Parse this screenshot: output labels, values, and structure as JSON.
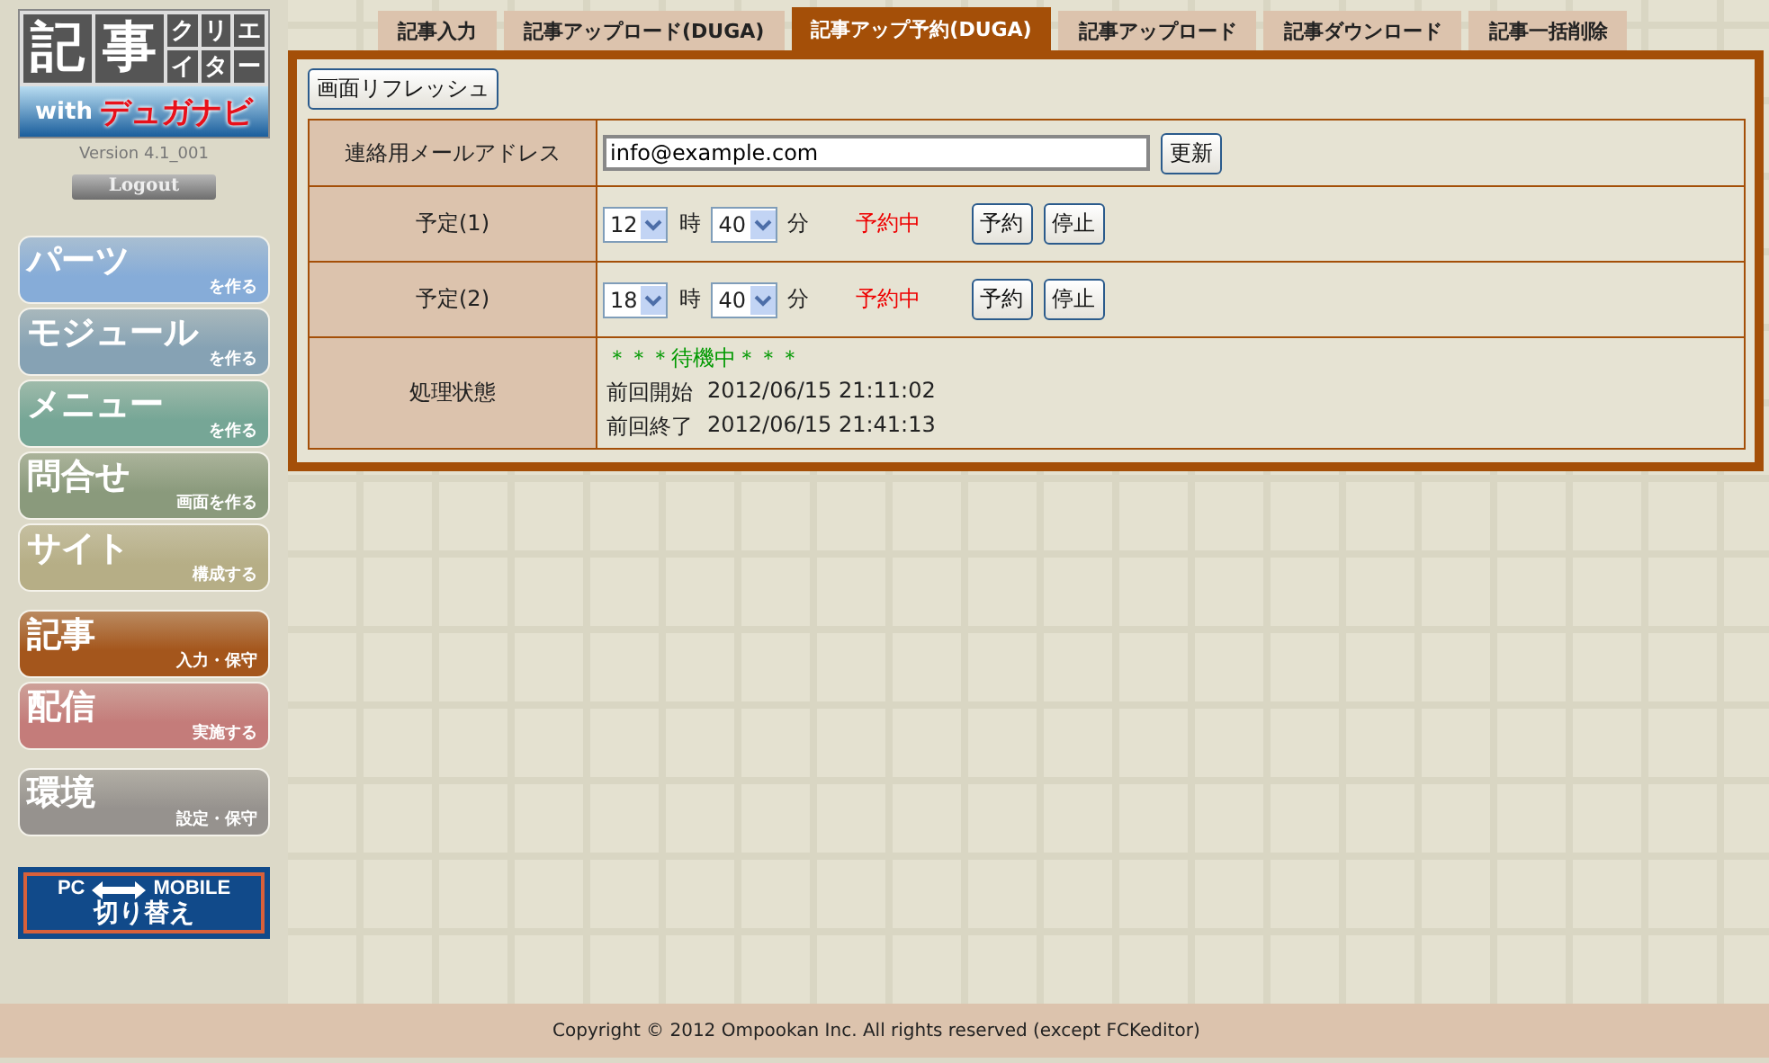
{
  "logo": {
    "main": [
      "記",
      "事"
    ],
    "cells": [
      "ク",
      "リ",
      "エ",
      "イ",
      "タ",
      "ー"
    ],
    "with": "with",
    "brand": "デュガナビ"
  },
  "version": "Version 4.1_001",
  "logout": "Logout",
  "nav_groups": [
    [
      {
        "big": "パーツ",
        "small": "を作る",
        "color": "#86acd8"
      },
      {
        "big": "モジュール",
        "small": "を作る",
        "color": "#86a2b4"
      },
      {
        "big": "メニュー",
        "small": "を作る",
        "color": "#76a696"
      },
      {
        "big": "問合せ",
        "small": "画面を作る",
        "color": "#8a9a7c"
      },
      {
        "big": "サイト",
        "small": "構成する",
        "color": "#b6ae86"
      }
    ],
    [
      {
        "big": "記事",
        "small": "入力・保守",
        "color": "#a4561c"
      },
      {
        "big": "配信",
        "small": "実施する",
        "color": "#c47c7a"
      }
    ],
    [
      {
        "big": "環境",
        "small": "設定・保守",
        "color": "#96928e"
      }
    ]
  ],
  "switch_banner": {
    "top_left": "PC",
    "top_right": "MOBILE",
    "bottom": "切り替え"
  },
  "tabs": [
    {
      "label": "記事入力",
      "selected": false
    },
    {
      "label": "記事アップロード(DUGA)",
      "selected": false
    },
    {
      "label": "記事アップ予約(DUGA)",
      "selected": true
    },
    {
      "label": "記事アップロード",
      "selected": false
    },
    {
      "label": "記事ダウンロード",
      "selected": false
    },
    {
      "label": "記事一括削除",
      "selected": false
    }
  ],
  "refresh_button": "画面リフレッシュ",
  "rows": [
    {
      "kind": "email",
      "label": "連絡用メールアドレス",
      "value": "info@example.com",
      "button": "更新"
    },
    {
      "kind": "schedule",
      "label": "予定(1)",
      "hour": "12",
      "hour_unit": "時",
      "minute": "40",
      "minute_unit": "分",
      "status": "予約中",
      "buttons": [
        "予約",
        "停止"
      ]
    },
    {
      "kind": "schedule",
      "label": "予定(2)",
      "hour": "18",
      "hour_unit": "時",
      "minute": "40",
      "minute_unit": "分",
      "status": "予約中",
      "buttons": [
        "予約",
        "停止"
      ]
    },
    {
      "kind": "status",
      "label": "処理状態",
      "state": "＊＊＊待機中＊＊＊",
      "lines": [
        {
          "label": "前回開始",
          "value": "2012/06/15 21:11:02"
        },
        {
          "label": "前回終了",
          "value": "2012/06/15 21:41:13"
        }
      ]
    }
  ],
  "footer": "Copyright © 2012 Ompookan Inc. All rights reserved (except FCKeditor)"
}
